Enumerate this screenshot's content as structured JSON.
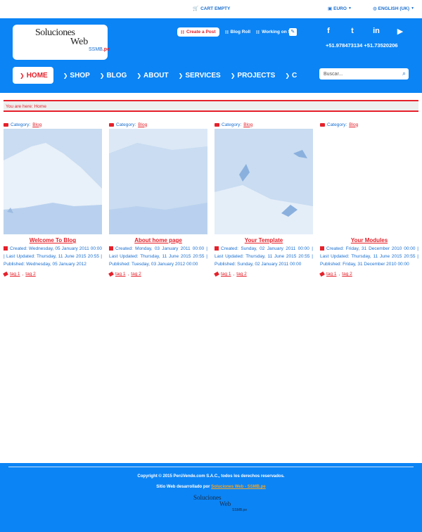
{
  "topbar": {
    "cart": "CART EMPTY",
    "currency": "EURO",
    "language": "ENGLISH (UK)"
  },
  "logo": {
    "line1": "Soluciones",
    "line2": "Web",
    "line3": "SSMB",
    "line3_suffix": ".pe"
  },
  "toplinks": {
    "create_post": "Create a Post",
    "blog_roll": "Blog Roll",
    "working_on": "Working on S"
  },
  "social": {
    "facebook": "f",
    "twitter": "t",
    "linkedin": "in",
    "youtube": "▶"
  },
  "phones": "+51.978473134 +51.73520206",
  "nav": [
    {
      "label": "HOME",
      "active": true
    },
    {
      "label": "SHOP"
    },
    {
      "label": "BLOG"
    },
    {
      "label": "ABOUT"
    },
    {
      "label": "SERVICES"
    },
    {
      "label": "PROJECTS"
    },
    {
      "label": "C"
    }
  ],
  "search": {
    "placeholder": "Buscar..."
  },
  "breadcrumb": "You are here: Home",
  "category_label": "Category:",
  "category_name": "Blog",
  "posts": [
    {
      "title": "Welcome To Blog",
      "meta": "Created: Wednesday, 05 January 2011 00:00 | Last Updated: Thursday, 11 June 2015 20:55 | Published: Wednesday, 05 January 2012",
      "tag1": "tag 1",
      "tag2": "tag 2"
    },
    {
      "title": "About home page",
      "meta": "Created: Monday, 03 January 2011 00:00 | Last Updated: Thursday, 11 June 2015 20:55 | Published: Tuesday, 03 January 2012 00:00",
      "tag1": "tag 1",
      "tag2": "tag 2"
    },
    {
      "title": "Your Template",
      "meta": "Created: Sunday, 02 January 2011 00:00 | Last Updated: Thursday, 11 June 2015 20:55 | Published: Sunday, 02 January 2011 00:00",
      "tag1": "tag 1",
      "tag2": "tag 2"
    },
    {
      "title": "Your Modules",
      "meta": "Created: Friday, 31 December 2010 00:00 | Last Updated: Thursday, 11 June 2015 20:55 | Published: Friday, 31 December 2010 00:00",
      "tag1": "tag 1",
      "tag2": "tag 2"
    }
  ],
  "footer": {
    "copyright": "Copyright © 2015 PerúVende.com S.A.C., todos los derechos reservados.",
    "dev_prefix": "Sitio Web desarrollado por",
    "dev_link": "Soluciones Web - SSMB.pe",
    "logo_line1": "Soluciones",
    "logo_line2": "Web",
    "logo_line3": "SSMB.pe"
  },
  "colors": {
    "brand_blue": "#0b84f5",
    "accent_red": "#e5212b",
    "link_orange": "#f6a623"
  }
}
